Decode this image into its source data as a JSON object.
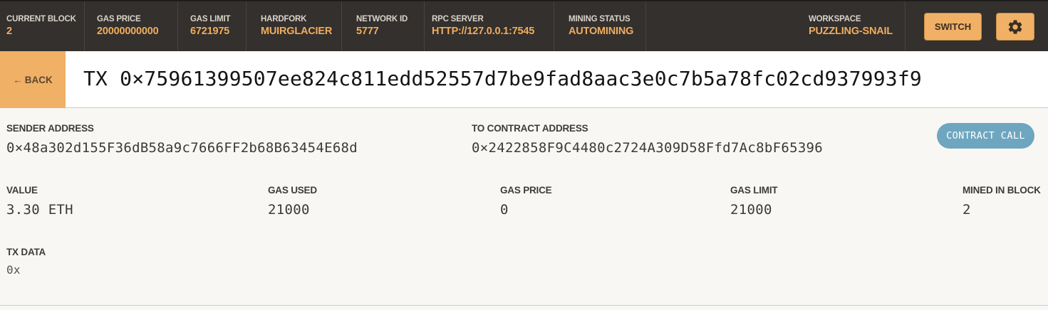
{
  "status_bar": {
    "current_block": {
      "label": "CURRENT BLOCK",
      "value": "2"
    },
    "gas_price": {
      "label": "GAS PRICE",
      "value": "20000000000"
    },
    "gas_limit": {
      "label": "GAS LIMIT",
      "value": "6721975"
    },
    "hardfork": {
      "label": "HARDFORK",
      "value": "MUIRGLACIER"
    },
    "network_id": {
      "label": "NETWORK ID",
      "value": "5777"
    },
    "rpc_server": {
      "label": "RPC SERVER",
      "value": "HTTP://127.0.0.1:7545"
    },
    "mining_status": {
      "label": "MINING STATUS",
      "value": "AUTOMINING"
    },
    "workspace": {
      "label": "WORKSPACE",
      "value": "PUZZLING-SNAIL"
    },
    "switch_label": "SWITCH",
    "settings_icon": "gear-icon"
  },
  "header": {
    "back_arrow": "←",
    "back_label": "BACK",
    "title": "TX 0×75961399507ee824c811edd52557d7be9fad8aac3e0c7b5a78fc02cd937993f9"
  },
  "tx": {
    "sender": {
      "label": "SENDER ADDRESS",
      "value": "0×48a302d155F36dB58a9c7666FF2b68B63454E68d"
    },
    "to_contract": {
      "label": "TO CONTRACT ADDRESS",
      "value": "0×2422858F9C4480c2724A309D58Ffd7Ac8bF65396"
    },
    "badge": "CONTRACT CALL",
    "value": {
      "label": "VALUE",
      "value": "3.30 ETH"
    },
    "gas_used": {
      "label": "GAS USED",
      "value": "21000"
    },
    "gas_price": {
      "label": "GAS PRICE",
      "value": "0"
    },
    "gas_limit": {
      "label": "GAS LIMIT",
      "value": "21000"
    },
    "mined_in_block": {
      "label": "MINED IN BLOCK",
      "value": "2"
    },
    "tx_data": {
      "label": "TX DATA",
      "value": "0x"
    }
  },
  "colors": {
    "topbar_bg": "#33302d",
    "accent_orange": "#f0b066",
    "stat_value": "#f0ac5f",
    "pill_blue": "#6ea6bf",
    "page_bg": "#f8f7f4"
  }
}
